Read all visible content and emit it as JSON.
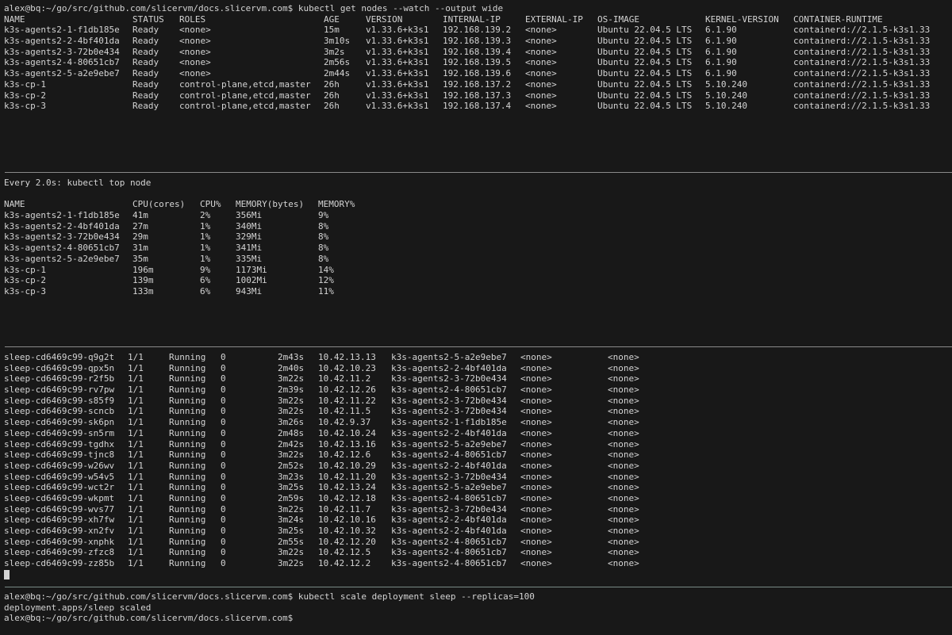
{
  "nodes_pane": {
    "command_line": "alex@bq:~/go/src/github.com/slicervm/docs.slicervm.com$ kubectl get nodes --watch --output wide",
    "headers": [
      "NAME",
      "STATUS",
      "ROLES",
      "AGE",
      "VERSION",
      "INTERNAL-IP",
      "EXTERNAL-IP",
      "OS-IMAGE",
      "KERNEL-VERSION",
      "CONTAINER-RUNTIME"
    ],
    "rows": [
      [
        "k3s-agents2-1-f1db185e",
        "Ready",
        "<none>",
        "15m",
        "v1.33.6+k3s1",
        "192.168.139.2",
        "<none>",
        "Ubuntu 22.04.5 LTS",
        "6.1.90",
        "containerd://2.1.5-k3s1.33"
      ],
      [
        "k3s-agents2-2-4bf401da",
        "Ready",
        "<none>",
        "3m10s",
        "v1.33.6+k3s1",
        "192.168.139.3",
        "<none>",
        "Ubuntu 22.04.5 LTS",
        "6.1.90",
        "containerd://2.1.5-k3s1.33"
      ],
      [
        "k3s-agents2-3-72b0e434",
        "Ready",
        "<none>",
        "3m2s",
        "v1.33.6+k3s1",
        "192.168.139.4",
        "<none>",
        "Ubuntu 22.04.5 LTS",
        "6.1.90",
        "containerd://2.1.5-k3s1.33"
      ],
      [
        "k3s-agents2-4-80651cb7",
        "Ready",
        "<none>",
        "2m56s",
        "v1.33.6+k3s1",
        "192.168.139.5",
        "<none>",
        "Ubuntu 22.04.5 LTS",
        "6.1.90",
        "containerd://2.1.5-k3s1.33"
      ],
      [
        "k3s-agents2-5-a2e9ebe7",
        "Ready",
        "<none>",
        "2m44s",
        "v1.33.6+k3s1",
        "192.168.139.6",
        "<none>",
        "Ubuntu 22.04.5 LTS",
        "6.1.90",
        "containerd://2.1.5-k3s1.33"
      ],
      [
        "k3s-cp-1",
        "Ready",
        "control-plane,etcd,master",
        "26h",
        "v1.33.6+k3s1",
        "192.168.137.2",
        "<none>",
        "Ubuntu 22.04.5 LTS",
        "5.10.240",
        "containerd://2.1.5-k3s1.33"
      ],
      [
        "k3s-cp-2",
        "Ready",
        "control-plane,etcd,master",
        "26h",
        "v1.33.6+k3s1",
        "192.168.137.3",
        "<none>",
        "Ubuntu 22.04.5 LTS",
        "5.10.240",
        "containerd://2.1.5-k3s1.33"
      ],
      [
        "k3s-cp-3",
        "Ready",
        "control-plane,etcd,master",
        "26h",
        "v1.33.6+k3s1",
        "192.168.137.4",
        "<none>",
        "Ubuntu 22.04.5 LTS",
        "5.10.240",
        "containerd://2.1.5-k3s1.33"
      ]
    ]
  },
  "top_pane": {
    "watch_header": "Every 2.0s: kubectl top node",
    "headers": [
      "NAME",
      "CPU(cores)",
      "CPU%",
      "MEMORY(bytes)",
      "MEMORY%"
    ],
    "rows": [
      [
        "k3s-agents2-1-f1db185e",
        "41m",
        "2%",
        "356Mi",
        "9%"
      ],
      [
        "k3s-agents2-2-4bf401da",
        "27m",
        "1%",
        "340Mi",
        "8%"
      ],
      [
        "k3s-agents2-3-72b0e434",
        "29m",
        "1%",
        "329Mi",
        "8%"
      ],
      [
        "k3s-agents2-4-80651cb7",
        "31m",
        "1%",
        "341Mi",
        "8%"
      ],
      [
        "k3s-agents2-5-a2e9ebe7",
        "35m",
        "1%",
        "335Mi",
        "8%"
      ],
      [
        "k3s-cp-1",
        "196m",
        "9%",
        "1173Mi",
        "14%"
      ],
      [
        "k3s-cp-2",
        "139m",
        "6%",
        "1002Mi",
        "12%"
      ],
      [
        "k3s-cp-3",
        "133m",
        "6%",
        "943Mi",
        "11%"
      ]
    ]
  },
  "pods_pane": {
    "rows": [
      [
        "sleep-cd6469c99-q9g2t",
        "1/1",
        "Running",
        "0",
        "2m43s",
        "10.42.13.13",
        "k3s-agents2-5-a2e9ebe7",
        "<none>",
        "<none>"
      ],
      [
        "sleep-cd6469c99-qpx5n",
        "1/1",
        "Running",
        "0",
        "2m40s",
        "10.42.10.23",
        "k3s-agents2-2-4bf401da",
        "<none>",
        "<none>"
      ],
      [
        "sleep-cd6469c99-r2f5b",
        "1/1",
        "Running",
        "0",
        "3m22s",
        "10.42.11.2",
        "k3s-agents2-3-72b0e434",
        "<none>",
        "<none>"
      ],
      [
        "sleep-cd6469c99-rv7pw",
        "1/1",
        "Running",
        "0",
        "2m39s",
        "10.42.12.26",
        "k3s-agents2-4-80651cb7",
        "<none>",
        "<none>"
      ],
      [
        "sleep-cd6469c99-s85f9",
        "1/1",
        "Running",
        "0",
        "3m22s",
        "10.42.11.22",
        "k3s-agents2-3-72b0e434",
        "<none>",
        "<none>"
      ],
      [
        "sleep-cd6469c99-scncb",
        "1/1",
        "Running",
        "0",
        "3m22s",
        "10.42.11.5",
        "k3s-agents2-3-72b0e434",
        "<none>",
        "<none>"
      ],
      [
        "sleep-cd6469c99-sk6pn",
        "1/1",
        "Running",
        "0",
        "3m26s",
        "10.42.9.37",
        "k3s-agents2-1-f1db185e",
        "<none>",
        "<none>"
      ],
      [
        "sleep-cd6469c99-sn5rm",
        "1/1",
        "Running",
        "0",
        "2m48s",
        "10.42.10.24",
        "k3s-agents2-2-4bf401da",
        "<none>",
        "<none>"
      ],
      [
        "sleep-cd6469c99-tgdhx",
        "1/1",
        "Running",
        "0",
        "2m42s",
        "10.42.13.16",
        "k3s-agents2-5-a2e9ebe7",
        "<none>",
        "<none>"
      ],
      [
        "sleep-cd6469c99-tjnc8",
        "1/1",
        "Running",
        "0",
        "3m22s",
        "10.42.12.6",
        "k3s-agents2-4-80651cb7",
        "<none>",
        "<none>"
      ],
      [
        "sleep-cd6469c99-w26wv",
        "1/1",
        "Running",
        "0",
        "2m52s",
        "10.42.10.29",
        "k3s-agents2-2-4bf401da",
        "<none>",
        "<none>"
      ],
      [
        "sleep-cd6469c99-w54v5",
        "1/1",
        "Running",
        "0",
        "3m23s",
        "10.42.11.20",
        "k3s-agents2-3-72b0e434",
        "<none>",
        "<none>"
      ],
      [
        "sleep-cd6469c99-wct2r",
        "1/1",
        "Running",
        "0",
        "3m25s",
        "10.42.13.24",
        "k3s-agents2-5-a2e9ebe7",
        "<none>",
        "<none>"
      ],
      [
        "sleep-cd6469c99-wkpmt",
        "1/1",
        "Running",
        "0",
        "2m59s",
        "10.42.12.18",
        "k3s-agents2-4-80651cb7",
        "<none>",
        "<none>"
      ],
      [
        "sleep-cd6469c99-wvs77",
        "1/1",
        "Running",
        "0",
        "3m22s",
        "10.42.11.7",
        "k3s-agents2-3-72b0e434",
        "<none>",
        "<none>"
      ],
      [
        "sleep-cd6469c99-xh7fw",
        "1/1",
        "Running",
        "0",
        "3m24s",
        "10.42.10.16",
        "k3s-agents2-2-4bf401da",
        "<none>",
        "<none>"
      ],
      [
        "sleep-cd6469c99-xn2fv",
        "1/1",
        "Running",
        "0",
        "3m25s",
        "10.42.10.32",
        "k3s-agents2-2-4bf401da",
        "<none>",
        "<none>"
      ],
      [
        "sleep-cd6469c99-xnphk",
        "1/1",
        "Running",
        "0",
        "2m55s",
        "10.42.12.20",
        "k3s-agents2-4-80651cb7",
        "<none>",
        "<none>"
      ],
      [
        "sleep-cd6469c99-zfzc8",
        "1/1",
        "Running",
        "0",
        "3m22s",
        "10.42.12.5",
        "k3s-agents2-4-80651cb7",
        "<none>",
        "<none>"
      ],
      [
        "sleep-cd6469c99-zz85b",
        "1/1",
        "Running",
        "0",
        "3m22s",
        "10.42.12.2",
        "k3s-agents2-4-80651cb7",
        "<none>",
        "<none>"
      ]
    ]
  },
  "shell_pane": {
    "lines": [
      "alex@bq:~/go/src/github.com/slicervm/docs.slicervm.com$ kubectl scale deployment sleep --replicas=100",
      "deployment.apps/sleep scaled",
      "alex@bq:~/go/src/github.com/slicervm/docs.slicervm.com$ "
    ]
  },
  "colors": {
    "background": "#181818",
    "foreground": "#d4d4d4",
    "divider": "#8a8a8a"
  }
}
